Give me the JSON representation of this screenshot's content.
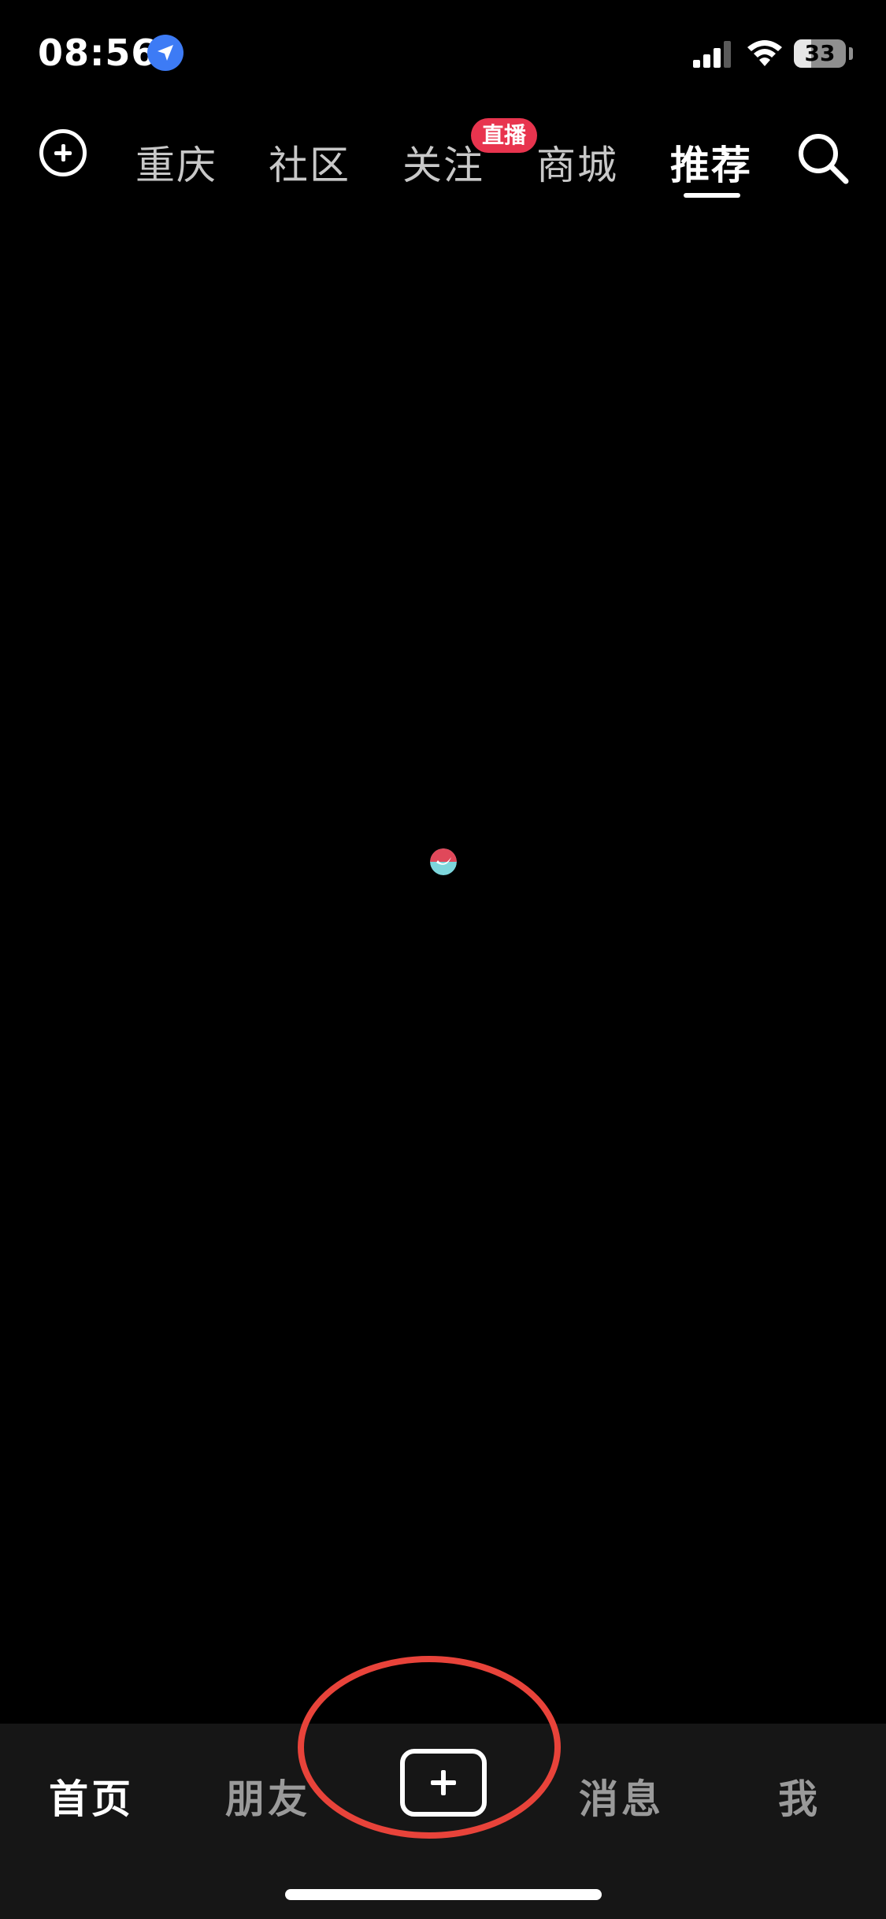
{
  "status_bar": {
    "time": "08:56",
    "battery": "33",
    "battery_level": 0.33
  },
  "top_nav": {
    "tabs": [
      {
        "label": "重庆"
      },
      {
        "label": "社区"
      },
      {
        "label": "关注"
      },
      {
        "label": "商城"
      },
      {
        "label": "推荐"
      }
    ],
    "active_tab": "推荐",
    "live_badge": "直播"
  },
  "bottom_nav": {
    "tabs": [
      {
        "label": "首页"
      },
      {
        "label": "朋友"
      },
      {
        "label": "消息"
      },
      {
        "label": "我"
      }
    ],
    "active_tab": "首页"
  },
  "colors": {
    "background": "#000000",
    "bottom_bar": "#161616",
    "badge": "#e8344e",
    "annotation": "#e8433a",
    "location": "#3d7bf5"
  },
  "icons": [
    "location-arrow-icon",
    "signal-icon",
    "wifi-icon",
    "battery-icon",
    "add-circle-icon",
    "search-icon",
    "publish-plus-icon",
    "loading-spinner-icon"
  ]
}
